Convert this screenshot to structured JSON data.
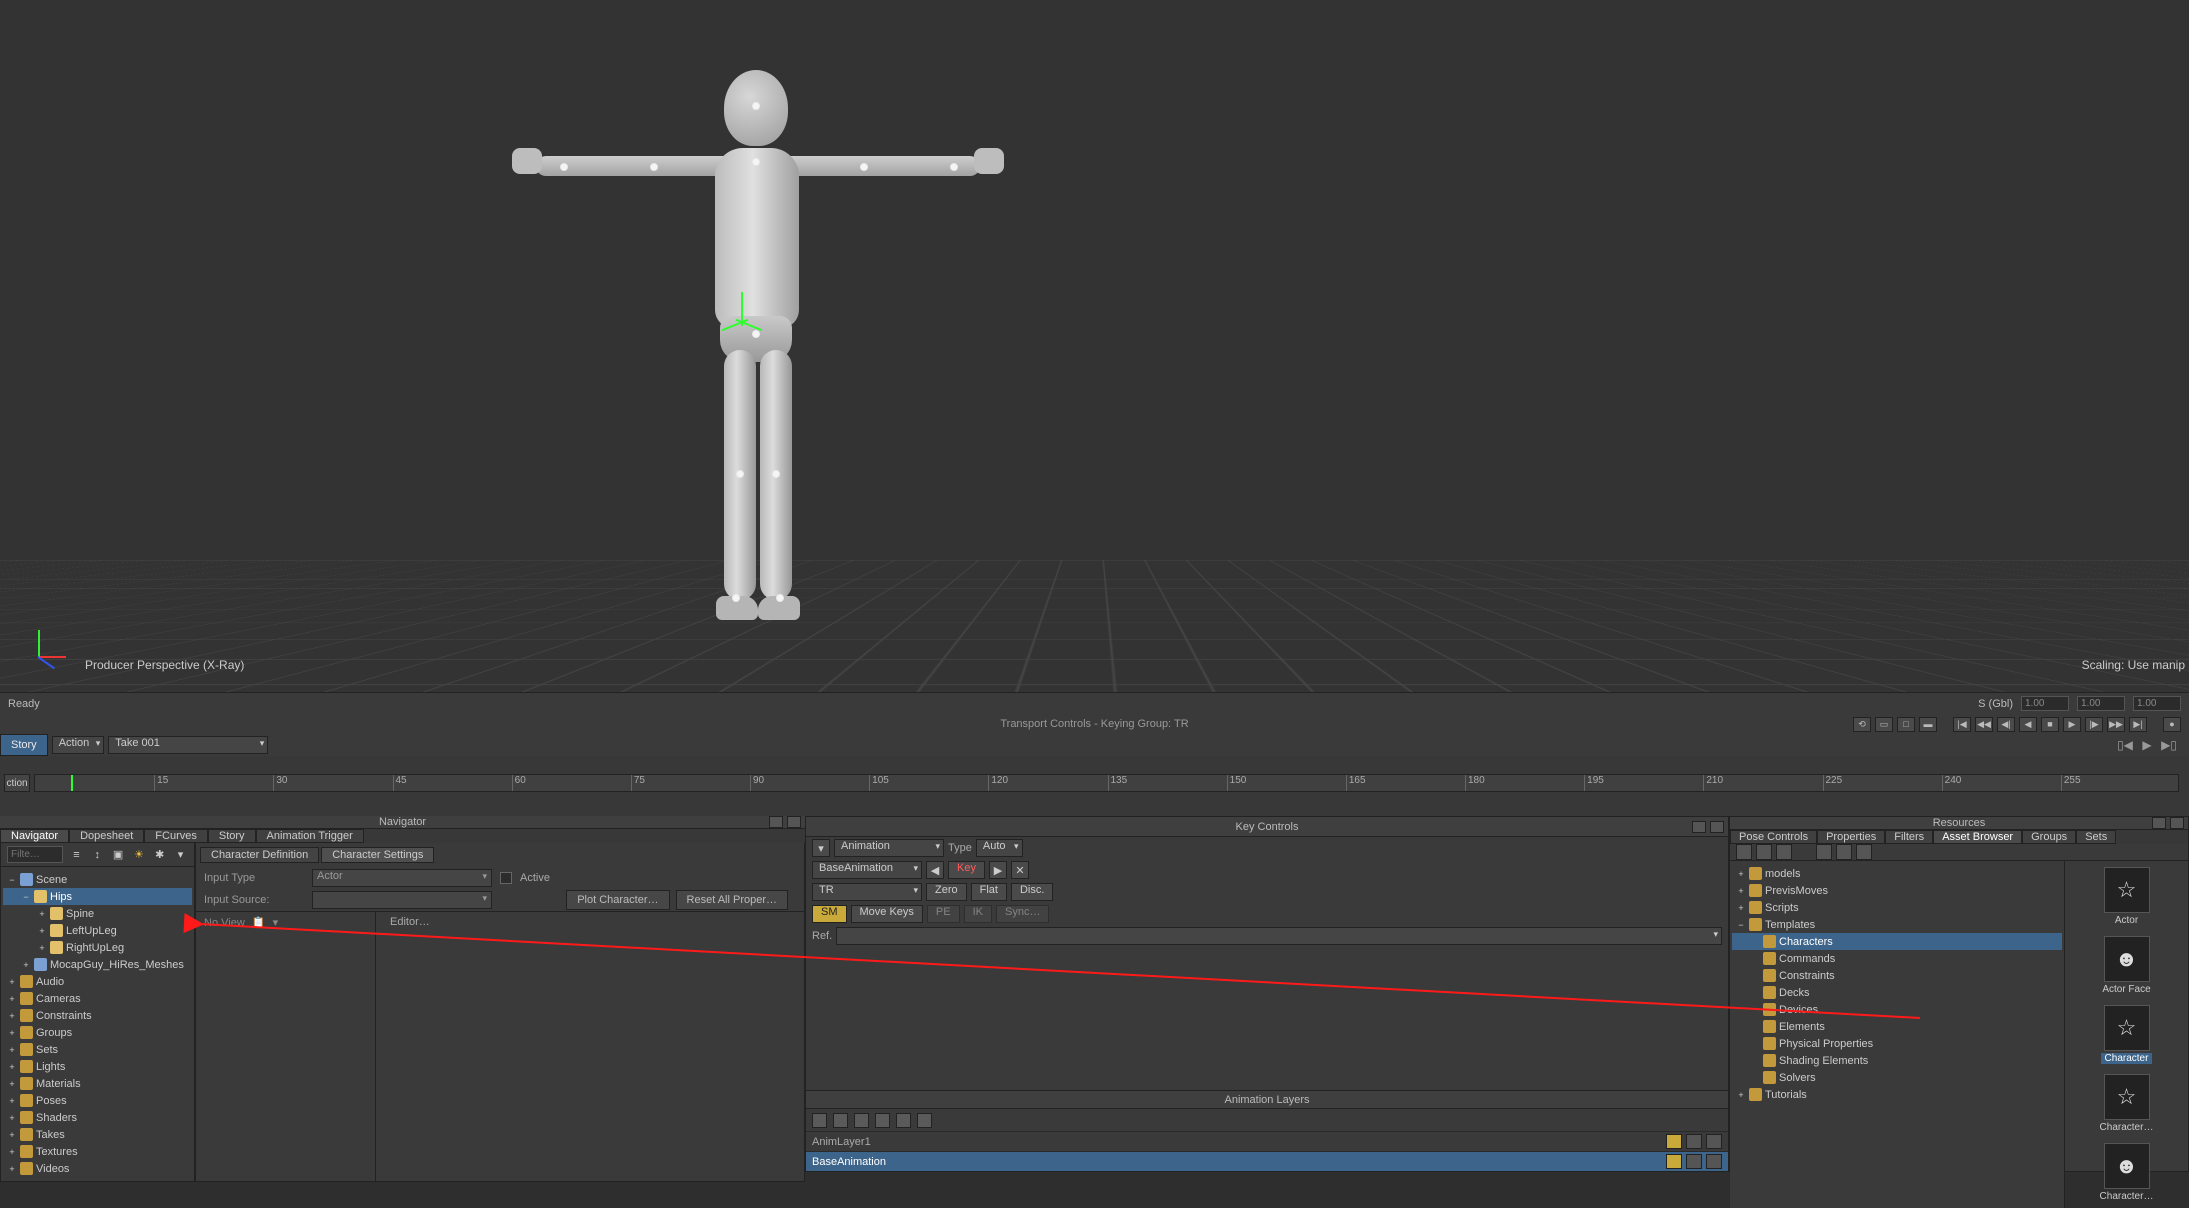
{
  "viewport": {
    "camera_label": "Producer Perspective (X-Ray)",
    "scaling_label": "Scaling: Use manip"
  },
  "status": {
    "left": "Ready",
    "right_mode": "S  (Gbl)",
    "right_val1": "1.00",
    "right_val2": "1.00",
    "right_val3": "1.00"
  },
  "transport": {
    "center": "Transport Controls  -  Keying Group: TR"
  },
  "story": {
    "tab_story": "Story",
    "dd_action": "Action",
    "dd_take": "Take 001"
  },
  "timeline": {
    "label": "ction",
    "ticks": [
      "15",
      "30",
      "45",
      "60",
      "75",
      "90",
      "105",
      "120",
      "135",
      "150",
      "165",
      "180",
      "195",
      "210",
      "225",
      "240",
      "255"
    ]
  },
  "navigator": {
    "title": "Navigator",
    "tabs": [
      "Navigator",
      "Dopesheet",
      "FCurves",
      "Story",
      "Animation Trigger"
    ],
    "filter_placeholder": "Filte…",
    "tree": [
      {
        "d": 0,
        "exp": "−",
        "ico": "cube",
        "label": "Scene",
        "sel": false
      },
      {
        "d": 1,
        "exp": "−",
        "ico": "bone",
        "label": "Hips",
        "sel": true
      },
      {
        "d": 2,
        "exp": "+",
        "ico": "bone",
        "label": "Spine",
        "sel": false
      },
      {
        "d": 2,
        "exp": "+",
        "ico": "bone",
        "label": "LeftUpLeg",
        "sel": false
      },
      {
        "d": 2,
        "exp": "+",
        "ico": "bone",
        "label": "RightUpLeg",
        "sel": false
      },
      {
        "d": 1,
        "exp": "+",
        "ico": "cube",
        "label": "MocapGuy_HiRes_Meshes",
        "sel": false
      },
      {
        "d": 0,
        "exp": "+",
        "ico": "folder",
        "label": "Audio",
        "sel": false
      },
      {
        "d": 0,
        "exp": "+",
        "ico": "folder",
        "label": "Cameras",
        "sel": false
      },
      {
        "d": 0,
        "exp": "+",
        "ico": "folder",
        "label": "Constraints",
        "sel": false
      },
      {
        "d": 0,
        "exp": "+",
        "ico": "folder",
        "label": "Groups",
        "sel": false
      },
      {
        "d": 0,
        "exp": "+",
        "ico": "folder",
        "label": "Sets",
        "sel": false
      },
      {
        "d": 0,
        "exp": "+",
        "ico": "folder",
        "label": "Lights",
        "sel": false
      },
      {
        "d": 0,
        "exp": "+",
        "ico": "folder",
        "label": "Materials",
        "sel": false
      },
      {
        "d": 0,
        "exp": "+",
        "ico": "folder",
        "label": "Poses",
        "sel": false
      },
      {
        "d": 0,
        "exp": "+",
        "ico": "folder",
        "label": "Shaders",
        "sel": false
      },
      {
        "d": 0,
        "exp": "+",
        "ico": "folder",
        "label": "Takes",
        "sel": false
      },
      {
        "d": 0,
        "exp": "+",
        "ico": "folder",
        "label": "Textures",
        "sel": false
      },
      {
        "d": 0,
        "exp": "+",
        "ico": "folder",
        "label": "Videos",
        "sel": false
      }
    ]
  },
  "character": {
    "tab_def": "Character Definition",
    "tab_set": "Character Settings",
    "lbl_input_type": "Input Type",
    "val_input_type": "Actor",
    "lbl_active": "Active",
    "lbl_input_source": "Input Source:",
    "btn_plot": "Plot Character…",
    "btn_reset": "Reset All Proper…",
    "no_view": "No View",
    "editor": "Editor…"
  },
  "keycontrols": {
    "title": "Key Controls",
    "dd_anim": "Animation",
    "lbl_type": "Type",
    "dd_type": "Auto",
    "dd_layer": "BaseAnimation",
    "btn_key": "Key",
    "dd_tr": "TR",
    "btn_zero": "Zero",
    "btn_flat": "Flat",
    "btn_disc": "Disc.",
    "btn_sm": "SM",
    "btn_movekeys": "Move Keys",
    "btn_pe": "PE",
    "btn_ik": "IK",
    "btn_sync": "Sync…",
    "lbl_ref": "Ref."
  },
  "animlayers": {
    "title": "Animation Layers",
    "rows": [
      "AnimLayer1",
      "BaseAnimation"
    ]
  },
  "resources": {
    "title": "Resources",
    "tabs": [
      "Pose Controls",
      "Properties",
      "Filters",
      "Asset Browser",
      "Groups",
      "Sets"
    ],
    "tree": [
      {
        "d": 0,
        "exp": "+",
        "ico": "folder",
        "label": "models",
        "sel": false
      },
      {
        "d": 0,
        "exp": "+",
        "ico": "folder",
        "label": "PrevisMoves",
        "sel": false
      },
      {
        "d": 0,
        "exp": "+",
        "ico": "folder",
        "label": "Scripts",
        "sel": false
      },
      {
        "d": 0,
        "exp": "−",
        "ico": "folder",
        "label": "Templates",
        "sel": false
      },
      {
        "d": 1,
        "exp": "",
        "ico": "folder",
        "label": "Characters",
        "sel": true
      },
      {
        "d": 1,
        "exp": "",
        "ico": "folder",
        "label": "Commands",
        "sel": false
      },
      {
        "d": 1,
        "exp": "",
        "ico": "folder",
        "label": "Constraints",
        "sel": false
      },
      {
        "d": 1,
        "exp": "",
        "ico": "folder",
        "label": "Decks",
        "sel": false
      },
      {
        "d": 1,
        "exp": "",
        "ico": "folder",
        "label": "Devices",
        "sel": false
      },
      {
        "d": 1,
        "exp": "",
        "ico": "folder",
        "label": "Elements",
        "sel": false
      },
      {
        "d": 1,
        "exp": "",
        "ico": "folder",
        "label": "Physical Properties",
        "sel": false
      },
      {
        "d": 1,
        "exp": "",
        "ico": "folder",
        "label": "Shading Elements",
        "sel": false
      },
      {
        "d": 1,
        "exp": "",
        "ico": "folder",
        "label": "Solvers",
        "sel": false
      },
      {
        "d": 0,
        "exp": "+",
        "ico": "folder",
        "label": "Tutorials",
        "sel": false
      }
    ],
    "previews": [
      {
        "label": "Actor",
        "sel": false,
        "glyph": "☆"
      },
      {
        "label": "Actor Face",
        "sel": false,
        "glyph": "☻"
      },
      {
        "label": "Character",
        "sel": true,
        "glyph": "☆"
      },
      {
        "label": "Character…",
        "sel": false,
        "glyph": "☆"
      },
      {
        "label": "Character…",
        "sel": false,
        "glyph": "☻"
      }
    ]
  }
}
